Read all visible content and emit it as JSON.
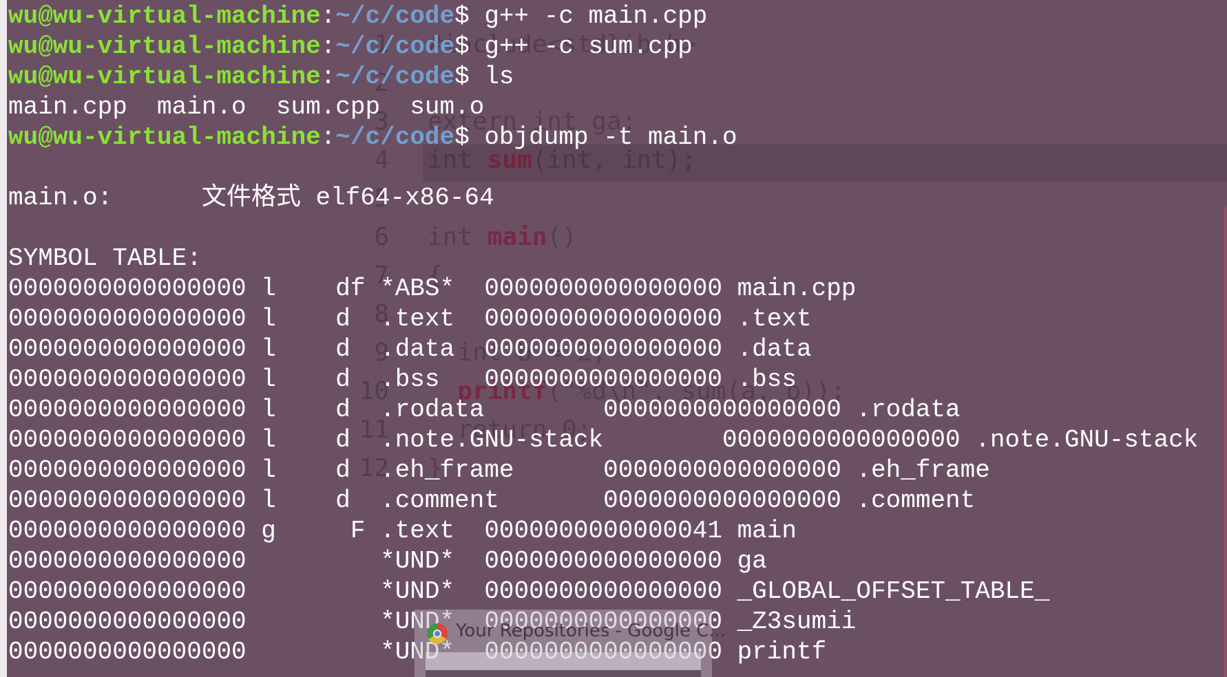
{
  "colors": {
    "background": "#6b5064",
    "user": "#8ae234",
    "path": "#729fcf",
    "text": "#ffffff"
  },
  "terminal": {
    "lines": [
      {
        "type": "prompt",
        "user": "wu@wu-virtual-machine",
        "sep": ":",
        "path": "~/c/code",
        "cmd": "$ g++ -c main.cpp"
      },
      {
        "type": "prompt",
        "user": "wu@wu-virtual-machine",
        "sep": ":",
        "path": "~/c/code",
        "cmd": "$ g++ -c sum.cpp"
      },
      {
        "type": "prompt",
        "user": "wu@wu-virtual-machine",
        "sep": ":",
        "path": "~/c/code",
        "cmd": "$ ls"
      },
      {
        "type": "output",
        "text": "main.cpp  main.o  sum.cpp  sum.o"
      },
      {
        "type": "prompt",
        "user": "wu@wu-virtual-machine",
        "sep": ":",
        "path": "~/c/code",
        "cmd": "$ objdump -t main.o"
      },
      {
        "type": "output",
        "text": ""
      },
      {
        "type": "output",
        "text": "main.o:      文件格式 elf64-x86-64"
      },
      {
        "type": "output",
        "text": ""
      },
      {
        "type": "output",
        "text": "SYMBOL TABLE:"
      },
      {
        "type": "output",
        "text": "0000000000000000 l    df *ABS*  0000000000000000 main.cpp"
      },
      {
        "type": "output",
        "text": "0000000000000000 l    d  .text  0000000000000000 .text"
      },
      {
        "type": "output",
        "text": "0000000000000000 l    d  .data  0000000000000000 .data"
      },
      {
        "type": "output",
        "text": "0000000000000000 l    d  .bss   0000000000000000 .bss"
      },
      {
        "type": "output",
        "text": "0000000000000000 l    d  .rodata        0000000000000000 .rodata"
      },
      {
        "type": "output",
        "text": "0000000000000000 l    d  .note.GNU-stack        0000000000000000 .note.GNU-stack"
      },
      {
        "type": "output",
        "text": "0000000000000000 l    d  .eh_frame      0000000000000000 .eh_frame"
      },
      {
        "type": "output",
        "text": "0000000000000000 l    d  .comment       0000000000000000 .comment"
      },
      {
        "type": "output",
        "text": "0000000000000000 g     F .text  0000000000000041 main"
      },
      {
        "type": "output",
        "text": "0000000000000000         *UND*  0000000000000000 ga"
      },
      {
        "type": "output",
        "text": "0000000000000000         *UND*  0000000000000000 _GLOBAL_OFFSET_TABLE_"
      },
      {
        "type": "output",
        "text": "0000000000000000         *UND*  0000000000000000 _Z3sumii"
      },
      {
        "type": "output",
        "text": "0000000000000000         *UND*  0000000000000000 printf"
      }
    ]
  },
  "background_editor": {
    "lines": [
      {
        "num": "1",
        "pre": "#include<stdlib.h>",
        "kw": "",
        "post": ""
      },
      {
        "num": "2",
        "pre": "",
        "kw": "",
        "post": ""
      },
      {
        "num": "3",
        "pre": "extern int ga;",
        "kw": "",
        "post": ""
      },
      {
        "num": "4",
        "pre": "int ",
        "kw": "sum",
        "post": "(int, int);"
      },
      {
        "num": "5",
        "pre": "",
        "kw": "",
        "post": ""
      },
      {
        "num": "6",
        "pre": "int ",
        "kw": "main",
        "post": "()"
      },
      {
        "num": "7",
        "pre": "{",
        "kw": "",
        "post": ""
      },
      {
        "num": "8",
        "pre": "",
        "kw": "",
        "post": ""
      },
      {
        "num": "9",
        "pre": "  int b = 2;",
        "kw": "",
        "post": ""
      },
      {
        "num": "10",
        "pre": "  ",
        "kw": "printf",
        "post": "(\"%d\\n\", sum(a, b));"
      },
      {
        "num": "11",
        "pre": "  return 0;",
        "kw": "",
        "post": ""
      },
      {
        "num": "12",
        "pre": "}",
        "kw": "",
        "post": ""
      }
    ]
  },
  "taskbar_tooltip": {
    "icon": "chrome-icon",
    "title": "Your Repositories - Google C..."
  }
}
